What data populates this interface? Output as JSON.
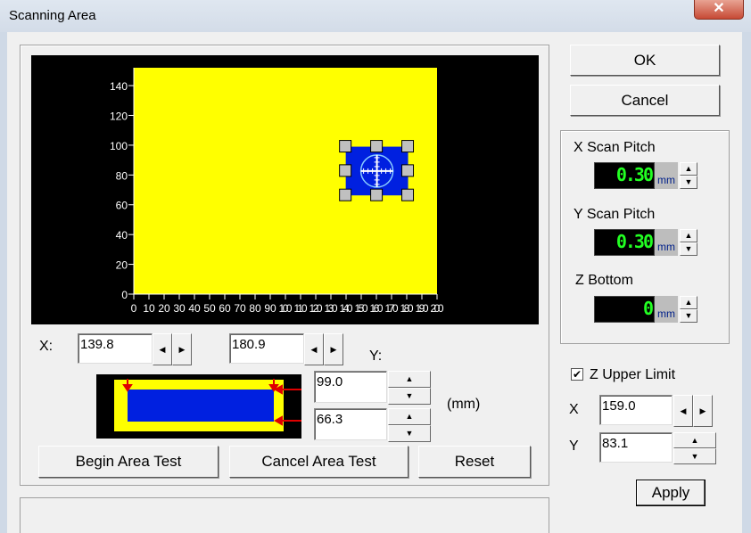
{
  "window": {
    "title": "Scanning Area",
    "close_glyph": "✕"
  },
  "buttons": {
    "ok": "OK",
    "cancel": "Cancel",
    "begin": "Begin Area Test",
    "cancel_test": "Cancel Area Test",
    "reset": "Reset",
    "apply": "Apply"
  },
  "pitch": {
    "x_label": "X Scan Pitch",
    "x_value": "0.30",
    "y_label": "Y Scan Pitch",
    "y_value": "0.30",
    "z_label": "Z Bottom",
    "z_value": "0",
    "unit": "mm"
  },
  "upper": {
    "label": "Z Upper Limit",
    "checked": true,
    "x_label": "X",
    "x_value": "159.0",
    "y_label": "Y",
    "y_value": "83.1"
  },
  "area": {
    "x_label": "X:",
    "y_label": "Y:",
    "x_min": "139.8",
    "x_max": "180.9",
    "y_max": "99.0",
    "y_min": "66.3",
    "unit": "(mm)"
  },
  "chart_data": {
    "type": "scatter",
    "xlim": [
      0,
      200
    ],
    "ylim": [
      0,
      152
    ],
    "x_ticks": [
      0,
      10,
      20,
      30,
      40,
      50,
      60,
      70,
      80,
      90,
      100,
      110,
      120,
      130,
      140,
      150,
      160,
      170,
      180,
      190,
      200
    ],
    "y_ticks": [
      0,
      20,
      40,
      60,
      80,
      100,
      120,
      140
    ],
    "selection": {
      "x_min": 139.8,
      "x_max": 180.9,
      "y_min": 66.3,
      "y_max": 99.0
    },
    "colors": {
      "bg": "#000000",
      "plot": "#ffff00",
      "selection": "#0020e0"
    }
  },
  "spin": {
    "up": "▲",
    "down": "▼",
    "left": "◀",
    "right": "▶"
  }
}
